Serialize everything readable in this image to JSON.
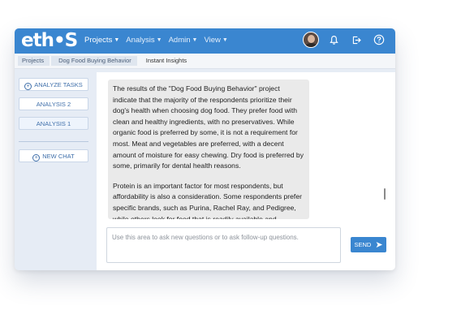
{
  "app": {
    "logo": "eth•S",
    "menu": [
      {
        "label": "Projects"
      },
      {
        "label": "Analysis"
      },
      {
        "label": "Admin"
      },
      {
        "label": "View"
      }
    ],
    "caret": "▼"
  },
  "breadcrumb": [
    "Projects",
    "Dog Food Buying Behavior",
    "Instant Insights"
  ],
  "sidebar": {
    "analyze_tasks": "ANALYZE TASKS",
    "analysis_2": "ANALYSIS 2",
    "analysis_1": "ANALYSIS 1",
    "new_chat": "NEW CHAT",
    "plus": "+"
  },
  "chat": {
    "paragraph_1": "The results of the \"Dog Food Buying Behavior\" project indicate that the majority of the respondents prioritize their dog's health when choosing dog food. They prefer food with clean and healthy ingredients, with no preservatives. While organic food is preferred by some, it is not a requirement for most. Meat and vegetables are preferred, with a decent amount of moisture for easy chewing. Dry food is preferred by some, primarily for dental health reasons.",
    "paragraph_2": "Protein is an important factor for most respondents, but affordability is also a consideration. Some respondents prefer specific brands, such as Purina, Rachel Ray, and Pedigree, while others look for food that is readily available and affordable. Grain-"
  },
  "input": {
    "placeholder": "Use this area to ask new questions or to ask follow-up questions.",
    "value": ""
  },
  "send_label": "SEND",
  "colors": {
    "brand": "#3a86d0",
    "panel": "#e6ecf5",
    "bubble": "#eaeaea"
  },
  "icons": [
    "avatar",
    "bell-icon",
    "logout-icon",
    "help-icon",
    "plus-circle-icon",
    "send-arrow-icon"
  ]
}
